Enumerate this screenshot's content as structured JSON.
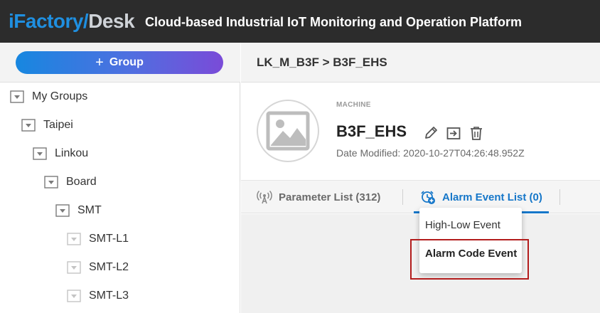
{
  "brand": {
    "logo_part1": "iFactory/",
    "logo_part2": "Desk",
    "app_title": "Cloud-based Industrial IoT Monitoring and Operation Platform"
  },
  "sidebar": {
    "group_button_icon": "+",
    "group_button_label": "Group",
    "tree": [
      {
        "label": "My Groups",
        "icon": "folder-collapse-icon"
      },
      {
        "label": "Taipei",
        "icon": "folder-collapse-icon"
      },
      {
        "label": "Linkou",
        "icon": "folder-collapse-icon"
      },
      {
        "label": "Board",
        "icon": "folder-collapse-icon"
      },
      {
        "label": "SMT",
        "icon": "folder-collapse-icon"
      },
      {
        "label": "SMT-L1",
        "icon": "folder-collapse-icon"
      },
      {
        "label": "SMT-L2",
        "icon": "folder-collapse-icon"
      },
      {
        "label": "SMT-L3",
        "icon": "folder-collapse-icon"
      }
    ]
  },
  "breadcrumb": "LK_M_B3F > B3F_EHS",
  "machine": {
    "kind": "MACHINE",
    "name": "B3F_EHS",
    "date_modified": "Date Modified: 2020-10-27T04:26:48.952Z",
    "actions": [
      "edit-icon",
      "move-icon",
      "delete-icon"
    ]
  },
  "tabs": {
    "parameter_list": "Parameter List (312)",
    "alarm_event_list": "Alarm Event List (0)",
    "active": "alarm_event_list"
  },
  "dropdown": {
    "items": [
      "High-Low Event",
      "Alarm Code Event"
    ],
    "highlighted": "Alarm Code Event"
  },
  "colors": {
    "accent": "#1677c9",
    "topbar": "#2c2c2c",
    "highlight_border": "#b31d1d"
  }
}
